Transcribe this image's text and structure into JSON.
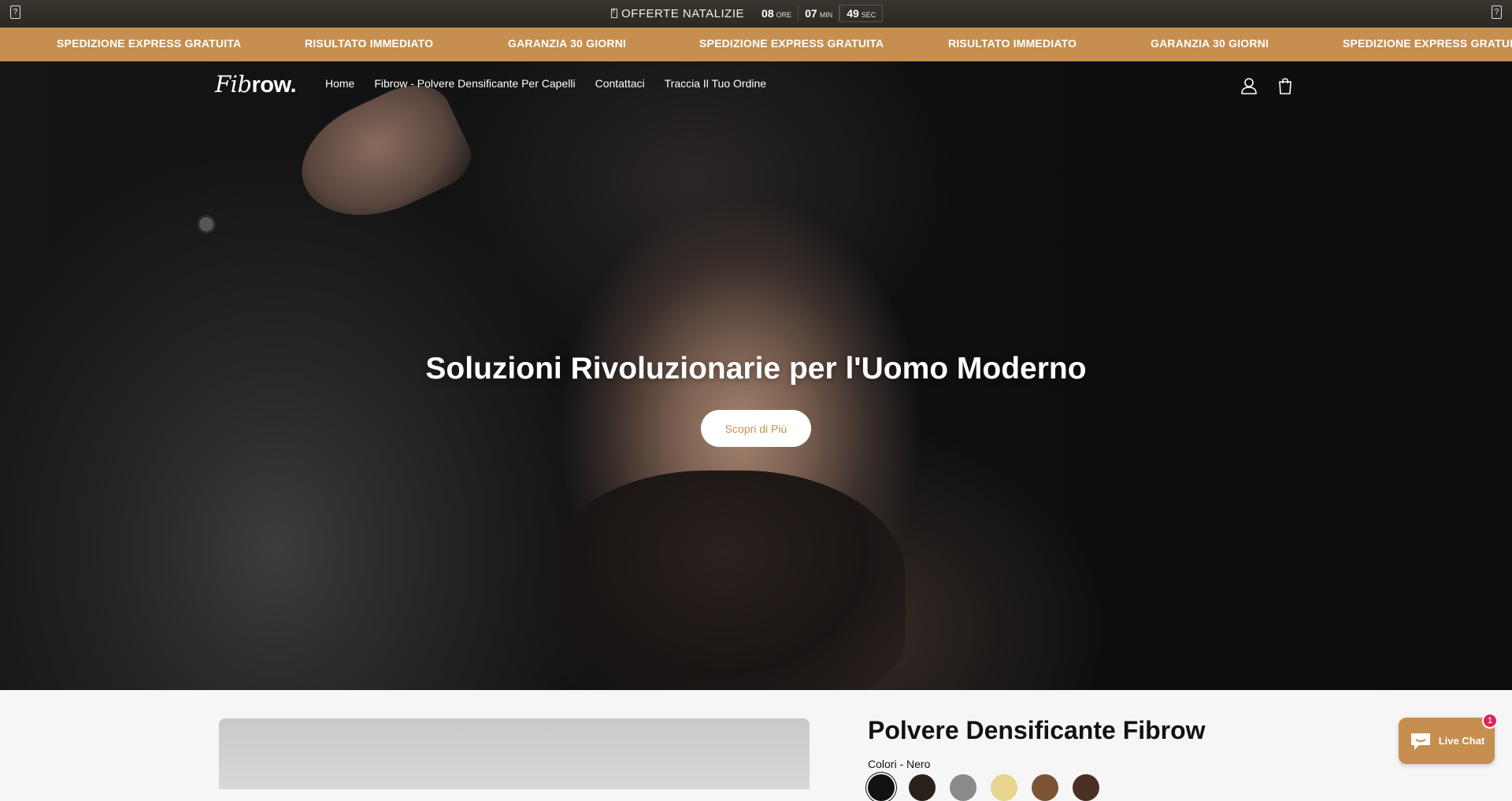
{
  "promo": {
    "corner_left": "?",
    "corner_right": "?",
    "gift_icon": "gift-icon",
    "title": "OFFERTE NATALIZIE",
    "countdown": [
      {
        "value": "08",
        "unit": "ORE"
      },
      {
        "value": "07",
        "unit": "MIN"
      },
      {
        "value": "49",
        "unit": "SEC"
      }
    ]
  },
  "marquee": {
    "items": [
      "SPEDIZIONE EXPRESS GRATUITA",
      "RISULTATO IMMEDIATO",
      "GARANZIA 30 GIORNI",
      "SPEDIZIONE EXPRESS GRATUITA",
      "RISULTATO IMMEDIATO",
      "GARANZIA 30 GIORNI",
      "SPEDIZIONE EXPRESS GRATUITA"
    ]
  },
  "header": {
    "logo_part1": "Fib",
    "logo_part2": "row.",
    "nav": [
      "Home",
      "Fibrow - Polvere Densificante Per Capelli",
      "Contattaci",
      "Traccia Il Tuo Ordine"
    ]
  },
  "hero": {
    "title": "Soluzioni Rivoluzionarie per l'Uomo Moderno",
    "cta": "Scopri di Più"
  },
  "product": {
    "title": "Polvere Densificante Fibrow",
    "variant_label": "Colori - Nero",
    "swatches": [
      "#111111",
      "#2b211c",
      "#8a8a8a",
      "#e6d48f",
      "#7a5434",
      "#4a2f25"
    ]
  },
  "chat": {
    "label": "Live Chat",
    "badge": "1",
    "accent": "#c68f4f"
  },
  "colors": {
    "accent": "#c68f4f",
    "promo_bg": "#2c2824"
  }
}
